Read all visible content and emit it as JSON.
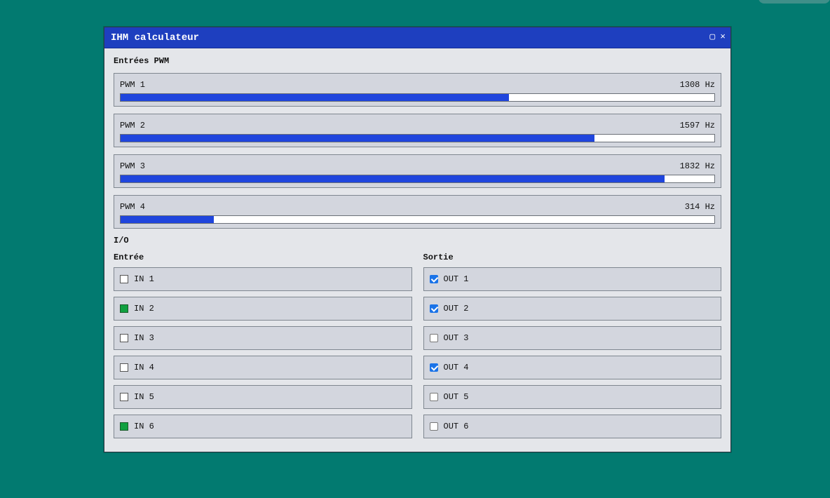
{
  "window": {
    "title": "IHM calculateur",
    "maximize_icon": "▢",
    "close_icon": "×"
  },
  "pwm": {
    "section_title": "Entrées PWM",
    "items": [
      {
        "label": "PWM 1",
        "value": "1308 Hz",
        "fill": 0.654
      },
      {
        "label": "PWM 2",
        "value": "1597 Hz",
        "fill": 0.798
      },
      {
        "label": "PWM 3",
        "value": "1832 Hz",
        "fill": 0.916
      },
      {
        "label": "PWM 4",
        "value": "314 Hz",
        "fill": 0.157
      }
    ]
  },
  "io": {
    "section_title": "I/O",
    "inputs": {
      "heading": "Entrée",
      "items": [
        {
          "label": "IN 1",
          "active": false
        },
        {
          "label": "IN 2",
          "active": true
        },
        {
          "label": "IN 3",
          "active": false
        },
        {
          "label": "IN 4",
          "active": false
        },
        {
          "label": "IN 5",
          "active": false
        },
        {
          "label": "IN 6",
          "active": true
        }
      ]
    },
    "outputs": {
      "heading": "Sortie",
      "items": [
        {
          "label": "OUT 1",
          "checked": true
        },
        {
          "label": "OUT 2",
          "checked": true
        },
        {
          "label": "OUT 3",
          "checked": false
        },
        {
          "label": "OUT 4",
          "checked": true
        },
        {
          "label": "OUT 5",
          "checked": false
        },
        {
          "label": "OUT 6",
          "checked": false
        }
      ]
    }
  },
  "colors": {
    "desktop": "#027a70",
    "titlebar": "#1e3fbf",
    "bar_fill": "#1f45dd",
    "led_on": "#10a040",
    "checkbox_on": "#1a73e8"
  }
}
